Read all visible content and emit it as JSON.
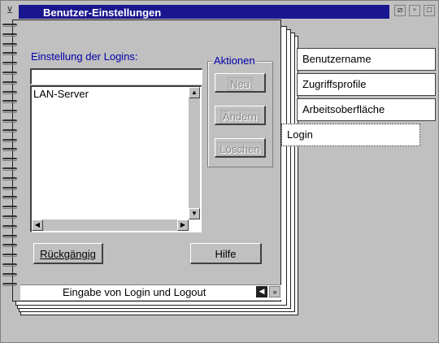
{
  "window": {
    "title": "Benutzer-Einstellungen",
    "sysmenu_icon": "system-menu-icon",
    "minimize_icon": "restore-icon",
    "maximize_icon": "maximize-icon"
  },
  "main": {
    "label": "Einstellung der Logins:",
    "input_value": "",
    "list_items": [
      "LAN-Server"
    ]
  },
  "actions": {
    "title": "Aktionen",
    "new_label": "Neu",
    "change_label": "Ändern",
    "delete_label": "Löschen"
  },
  "buttons": {
    "undo_label": "Rückgängig",
    "help_label": "Hilfe"
  },
  "tabs": [
    {
      "label": "Benutzername",
      "selected": false
    },
    {
      "label": "Zugriffsprofile",
      "selected": false
    },
    {
      "label": "Arbeitsoberfläche",
      "selected": false
    },
    {
      "label": "Login",
      "selected": true
    }
  ],
  "status": {
    "text": "Eingabe von Login und Logout",
    "prev_icon": "page-back-icon",
    "next_icon": "page-forward-icon"
  },
  "colors": {
    "titlebar": "#1a168f",
    "label_blue": "#0000a8",
    "background": "#c0c0c0"
  }
}
